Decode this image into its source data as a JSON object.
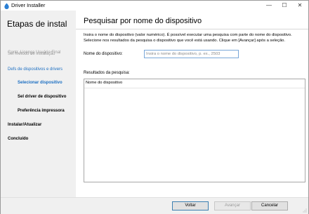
{
  "window": {
    "title": "Driver Installer",
    "minimize_glyph": "—",
    "maximize_glyph": "☐",
    "close_glyph": "✕"
  },
  "sidebar": {
    "title": "Etapas de instal",
    "items": [
      {
        "label": "Contr. Licença Usuário Final"
      },
      {
        "label": "Sel método de instalação"
      },
      {
        "label": "Defs de dispositivos e drivers"
      },
      {
        "label": "Selecionar dispositivo"
      },
      {
        "label": "Sel driver de dispositivo"
      },
      {
        "label": "Preferência impressora"
      },
      {
        "label": "Instalar/Atualizar"
      },
      {
        "label": "Concluído"
      }
    ]
  },
  "main": {
    "title": "Pesquisar por nome do dispositivo",
    "description": "Insira o nome do dispositivo (valor numérico). É possível executar uma pesquisa com parte do nome do dispositivo. Selecione nos resultados da pesquisa o dispositivo que você está usando. Clique em [Avançar] após a seleção.",
    "device_label": "Nome do dispositivo:",
    "device_value": "",
    "device_placeholder": "Insira o nome do dispositivo, p. ex., 2503",
    "results_label": "Resultados da pesquisa:",
    "results_column": "Nome do dispositivo"
  },
  "footer": {
    "back_label": "Voltar",
    "next_label": "Avançar",
    "cancel_label": "Cancelar"
  },
  "colors": {
    "accent": "#1b6ec2",
    "sidebar_bg": "#f0f0f0",
    "disabled_text": "#9a9a9a"
  }
}
